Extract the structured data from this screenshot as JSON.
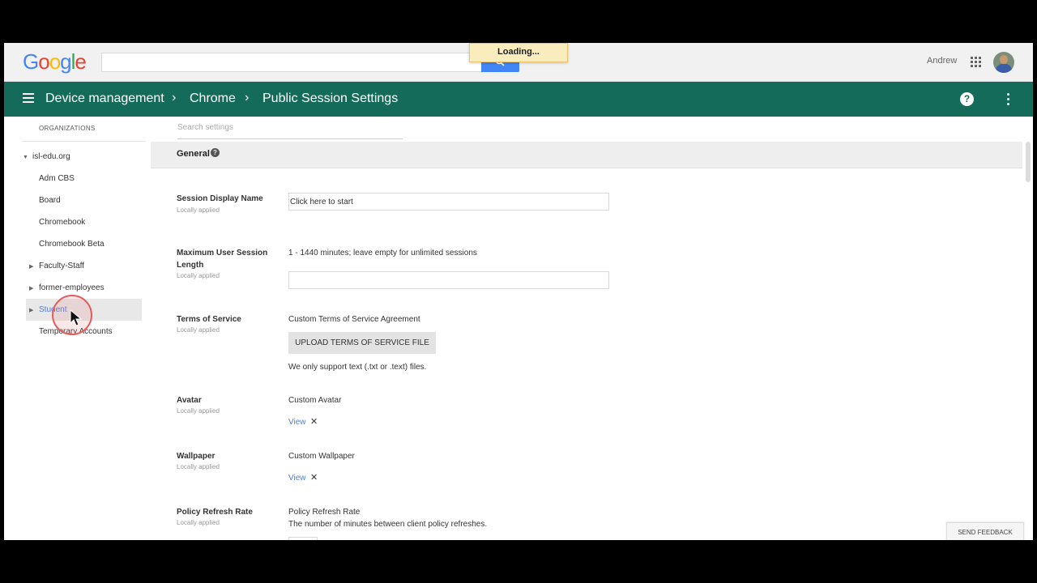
{
  "topbar": {
    "logo_letters": [
      "G",
      "o",
      "o",
      "g",
      "l",
      "e"
    ],
    "loading": "Loading...",
    "user_name": "Andrew"
  },
  "header": {
    "breadcrumbs": [
      "Device management",
      "Chrome",
      "Public Session Settings"
    ],
    "help_icon_label": "?"
  },
  "sidebar": {
    "title": "ORGANIZATIONS",
    "items": [
      {
        "label": "isl-edu.org",
        "expand": "▼"
      },
      {
        "label": "Adm CBS"
      },
      {
        "label": "Board"
      },
      {
        "label": "Chromebook"
      },
      {
        "label": "Chromebook Beta"
      },
      {
        "label": "Faculty-Staff",
        "expand": "▶"
      },
      {
        "label": "former-employees",
        "expand": "▶"
      },
      {
        "label": "Student",
        "expand": "▶",
        "selected": true
      },
      {
        "label": "Temporary Accounts"
      }
    ]
  },
  "main": {
    "search_placeholder": "Search settings",
    "section_title": "General",
    "section_help": "?",
    "settings": {
      "display_name": {
        "label": "Session Display Name",
        "sub": "Locally applied",
        "value": "Click here to start"
      },
      "max_length": {
        "label": "Maximum User Session Length",
        "sub": "Locally applied",
        "hint": "1 - 1440 minutes; leave empty for unlimited sessions",
        "value": ""
      },
      "terms": {
        "label": "Terms of Service",
        "sub": "Locally applied",
        "heading": "Custom Terms of Service Agreement",
        "button": "UPLOAD TERMS OF SERVICE FILE",
        "note": "We only support text (.txt or .text) files."
      },
      "avatar": {
        "label": "Avatar",
        "sub": "Locally applied",
        "heading": "Custom Avatar",
        "link": "View",
        "remove": "✕"
      },
      "wallpaper": {
        "label": "Wallpaper",
        "sub": "Locally applied",
        "heading": "Custom Wallpaper",
        "link": "View",
        "remove": "✕"
      },
      "refresh": {
        "label": "Policy Refresh Rate",
        "sub": "Locally applied",
        "heading": "Policy Refresh Rate",
        "desc": "The number of minutes between client policy refreshes."
      }
    },
    "feedback": "SEND FEEDBACK"
  },
  "colors": {
    "header": "#156b5a",
    "link": "#4a7fd8",
    "search_button": "#4285f4"
  }
}
